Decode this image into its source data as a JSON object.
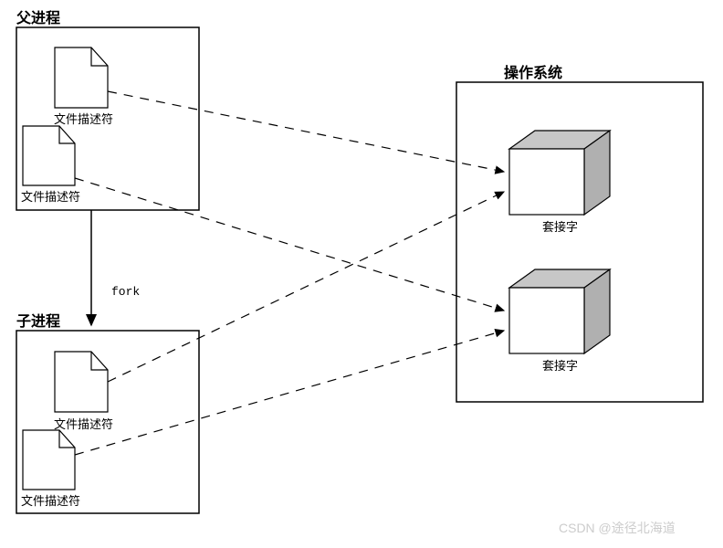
{
  "parent_process": {
    "title": "父进程",
    "fd1_label": "文件描述符",
    "fd2_label": "文件描述符"
  },
  "child_process": {
    "title": "子进程",
    "fd1_label": "文件描述符",
    "fd2_label": "文件描述符"
  },
  "os": {
    "title": "操作系统",
    "socket1_label": "套接字",
    "socket2_label": "套接字"
  },
  "fork_label": "fork",
  "watermark": "CSDN @途径北海道"
}
